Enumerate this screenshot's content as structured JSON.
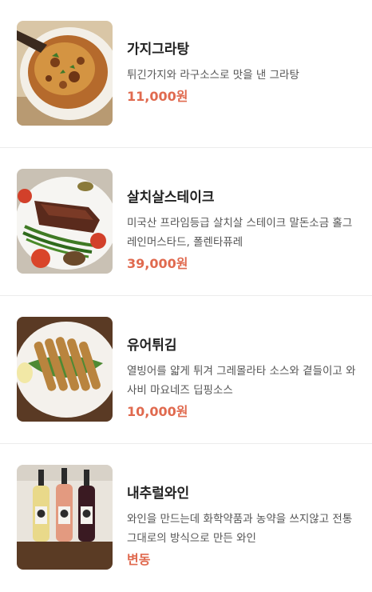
{
  "colors": {
    "price": "#e06a4f",
    "name": "#222222",
    "desc": "#555555",
    "divider": "#ececec"
  },
  "menu": {
    "items": [
      {
        "name": "가지그라탕",
        "description": "튀긴가지와 라구소스로 맛을 낸 그라탕",
        "price": "11,000원",
        "image_icon": "eggplant-gratin-photo"
      },
      {
        "name": "살치살스테이크",
        "description": "미국산 프라임등급 살치살 스테이크 말돈소금 홀그레인머스타드, 폴렌타퓨레",
        "price": "39,000원",
        "image_icon": "steak-photo"
      },
      {
        "name": "유어튀김",
        "description": "열빙어를 얇게 튀겨 그레몰라타 소스와 곁들이고 와사비 마요네즈 딥핑소스",
        "price": "10,000원",
        "image_icon": "fried-fish-photo"
      },
      {
        "name": "내추럴와인",
        "description": "와인을 만드는데 화학약품과 농약을 쓰지않고 전통그대로의 방식으로 만든 와인",
        "price": "변동",
        "image_icon": "wine-bottles-photo"
      }
    ]
  }
}
